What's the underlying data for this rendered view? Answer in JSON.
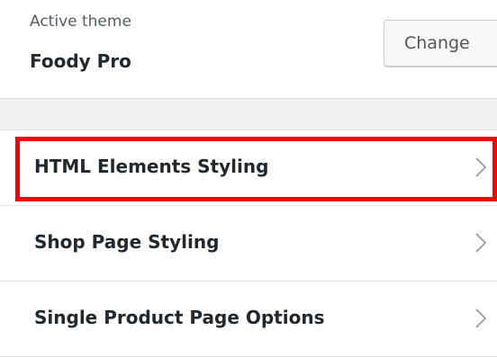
{
  "theme": {
    "label": "Active theme",
    "name": "Foody Pro",
    "change_label": "Change"
  },
  "sections": [
    {
      "title": "HTML Elements Styling",
      "highlighted": true,
      "icon": "chevron-right-icon"
    },
    {
      "title": "Shop Page Styling",
      "highlighted": false,
      "icon": "chevron-right-icon"
    },
    {
      "title": "Single Product Page Options",
      "highlighted": false,
      "icon": "chevron-right-icon"
    }
  ],
  "colors": {
    "highlight": "#ff0000",
    "panel_bg": "#ffffff",
    "band_bg": "#f1f1f1",
    "text": "#23282d",
    "chevron": "#a0a5aa"
  }
}
